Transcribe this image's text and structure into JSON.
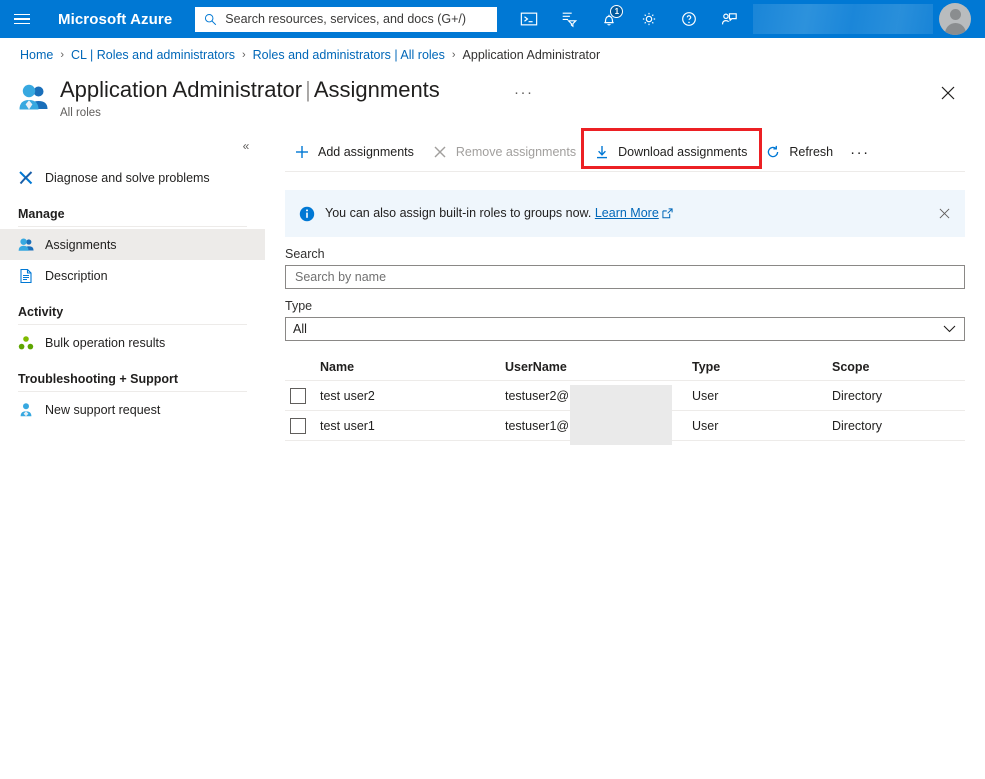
{
  "topbar": {
    "menu_icon": "hamburger-icon",
    "brand": "Microsoft Azure",
    "search": {
      "icon": "search-icon",
      "placeholder": "Search resources, services, and docs (G+/)",
      "value": ""
    },
    "icons": [
      {
        "name": "cloud-shell-icon",
        "label": "Cloud Shell"
      },
      {
        "name": "directories-subscriptions-icon",
        "label": "Directories + subscriptions"
      },
      {
        "name": "notifications-bell-icon",
        "label": "Notifications",
        "badge": "1"
      },
      {
        "name": "settings-gear-icon",
        "label": "Settings"
      },
      {
        "name": "help-question-icon",
        "label": "Help"
      },
      {
        "name": "feedback-icon",
        "label": "Feedback"
      }
    ],
    "account_redacted": "",
    "avatar": "user-avatar"
  },
  "breadcrumb": [
    {
      "label": "Home",
      "current": false
    },
    {
      "label": "CL | Roles and administrators",
      "current": false
    },
    {
      "label": "Roles and administrators | All roles",
      "current": false
    },
    {
      "label": "Application Administrator",
      "current": true
    }
  ],
  "page": {
    "icon": "role-members-icon",
    "title": "Application Administrator",
    "title_separator": "|",
    "subtitle_title": "Assignments",
    "subtitle": "All roles",
    "more_menu": "···",
    "close": "close-icon"
  },
  "sidebar": {
    "collapse_label": "«",
    "items": [
      {
        "label": "Diagnose and solve problems",
        "icon": "wrench-screwdriver-icon",
        "selected": false
      },
      {
        "label": "Assignments",
        "icon": "assignments-people-icon",
        "selected": true
      },
      {
        "label": "Description",
        "icon": "description-document-icon",
        "selected": false
      },
      {
        "label": "Bulk operation results",
        "icon": "bulk-operations-icon",
        "selected": false
      },
      {
        "label": "New support request",
        "icon": "support-person-icon",
        "selected": false
      }
    ],
    "groups": [
      {
        "label": "Manage"
      },
      {
        "label": "Activity"
      },
      {
        "label": "Troubleshooting + Support"
      }
    ]
  },
  "toolbar": {
    "add_label": "Add assignments",
    "remove_label": "Remove assignments",
    "download_label": "Download assignments",
    "refresh_label": "Refresh",
    "more_label": "···",
    "highlight_color": "#ec2024",
    "highlighted_command": "Download assignments"
  },
  "infobar": {
    "icon": "info-circle-icon",
    "text": "You can also assign built-in roles to groups now.",
    "link_label": "Learn More",
    "external_icon": "external-link-icon",
    "close": "close-icon",
    "background": "#eff6fc"
  },
  "filters": {
    "search_label": "Search",
    "search_placeholder": "Search by name",
    "search_value": "",
    "type_label": "Type",
    "type_value": "All",
    "type_chevron": "chevron-down-icon"
  },
  "table": {
    "columns": [
      "Name",
      "UserName",
      "Type",
      "Scope"
    ],
    "rows": [
      {
        "checked": false,
        "name": "test user2",
        "username": "testuser2@",
        "type": "User",
        "scope": "Directory"
      },
      {
        "checked": false,
        "name": "test user1",
        "username": "testuser1@",
        "type": "User",
        "scope": "Directory"
      }
    ]
  },
  "colors": {
    "azure_blue": "#0078d4",
    "link_blue": "#0067b8",
    "text": "#201f1e",
    "muted": "#605e5c",
    "disabled": "#a19f9d",
    "selected_nav": "#edebe9",
    "redaction_gray": "#eaeaea"
  }
}
